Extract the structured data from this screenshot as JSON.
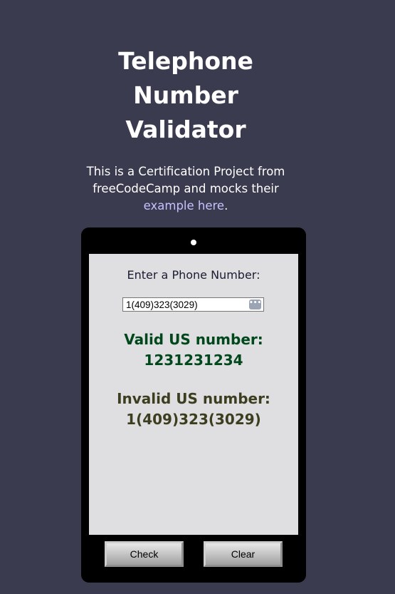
{
  "header": {
    "title_lines": [
      "Telephone",
      "Number",
      "Validator"
    ]
  },
  "intro": {
    "line1": "This is a Certification Project from",
    "line2_prefix": "freeCodeCamp and mocks their",
    "link_text": "example here",
    "line3_suffix": "."
  },
  "screen": {
    "input_label": "Enter a Phone Number:",
    "input_value": "1(409)323(3029)",
    "input_icon": "autofill-dots-icon",
    "results": [
      {
        "label": "Valid US number:",
        "number": "1231231234",
        "color": "#00471b"
      },
      {
        "label": "Invalid US number:",
        "number": "1(409)323(3029)",
        "color": "#3d3d1f"
      }
    ]
  },
  "buttons": {
    "check": "Check",
    "clear": "Clear"
  },
  "colors": {
    "background": "#3b3b4f",
    "phone_body": "#000000",
    "screen": "#dfdfe2",
    "link": "#c7c2ff"
  }
}
